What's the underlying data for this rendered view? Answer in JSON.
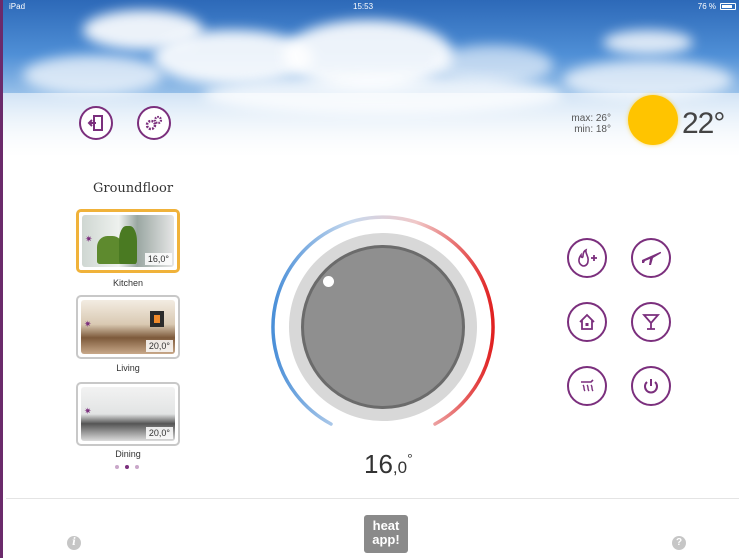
{
  "status_bar": {
    "carrier": "iPad",
    "time": "15:53",
    "battery": "76 %"
  },
  "weather": {
    "max": "max: 26°",
    "min": "min: 18°",
    "outside_temp": "22°",
    "sun_color": "#ffc400"
  },
  "toolbar": {
    "exit_icon": "exit-door-icon",
    "settings_icon": "settings-gears-icon"
  },
  "floor": {
    "title": "Groundfloor"
  },
  "rooms": [
    {
      "name": "Kitchen",
      "temp": "16,0°",
      "selected": true
    },
    {
      "name": "Living",
      "temp": "20,0°",
      "selected": false
    },
    {
      "name": "Dining",
      "temp": "20,0°",
      "selected": false
    }
  ],
  "pager": {
    "pages": 3,
    "current": 2
  },
  "thermostat": {
    "setpoint_int": "16",
    "setpoint_dec": ",0",
    "unit": "°"
  },
  "modes": [
    {
      "icon": "boost-flame-icon"
    },
    {
      "icon": "airplane-icon"
    },
    {
      "icon": "home-icon"
    },
    {
      "icon": "cocktail-icon"
    },
    {
      "icon": "hot-water-shower-icon"
    },
    {
      "icon": "power-icon"
    }
  ],
  "footer": {
    "logo_line1": "heat",
    "logo_line2": "app!"
  },
  "colors": {
    "accent": "#7b2f7d",
    "cold": "#4a8fd8",
    "hot": "#e02020"
  }
}
